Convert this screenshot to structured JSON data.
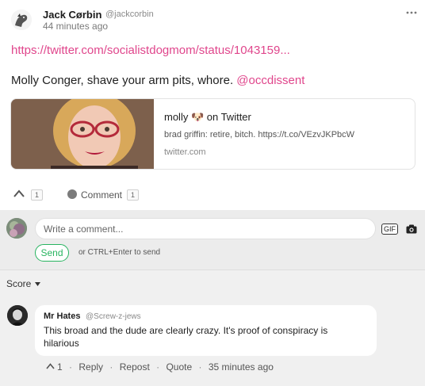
{
  "post": {
    "author_name": "Jack Cørbin",
    "author_handle": "@jackcorbin",
    "timestamp": "44 minutes ago",
    "link": "https://twitter.com/socialistdogmom/status/1043159...",
    "text": "Molly Conger, shave your arm pits, whore.",
    "mention": "@occdissent",
    "link_card": {
      "title": "molly 🐶 on Twitter",
      "description": "brad griffin: retire, bitch. https://t.co/VEzvJKPbcW",
      "domain": "twitter.com"
    },
    "upvote_count": "1",
    "comment_label": "Comment",
    "comment_count": "1"
  },
  "composer": {
    "placeholder": "Write a comment...",
    "gif_label": "GIF",
    "send_label": "Send",
    "hint": "or CTRL+Enter to send"
  },
  "comments": {
    "sort_label": "Score",
    "items": [
      {
        "author": "Mr Hates",
        "handle": "@Screw-z-jews",
        "body": "This broad and the dude are clearly crazy. It's proof of conspiracy is hilarious",
        "upvotes": "1",
        "reply_label": "Reply",
        "repost_label": "Repost",
        "quote_label": "Quote",
        "time": "35 minutes ago"
      }
    ]
  },
  "colors": {
    "link": "#e0468c",
    "send": "#28b460",
    "composer_bg": "#ececec",
    "comments_bg": "#f0f0f0"
  },
  "icons": [
    "user-avatar-icon",
    "more-options-icon",
    "upvote-chevron-icon",
    "comment-bubble-icon",
    "camera-icon",
    "caret-down-icon"
  ]
}
